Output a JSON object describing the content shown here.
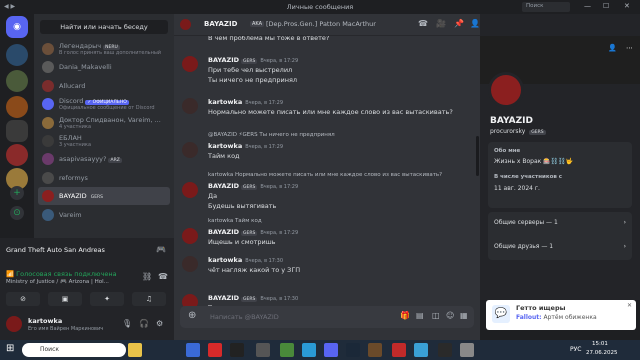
{
  "window": {
    "title": "Личные сообщения"
  },
  "search": {
    "label": "Найти или начать беседу",
    "top_placeholder": "Поиск"
  },
  "dms": [
    {
      "name": "Легендарыч",
      "tag": "NERU",
      "sub": "В голос принять ваш дополнительный",
      "color": "#6b4f3a"
    },
    {
      "name": "Dania_Makavelli",
      "tag": "",
      "sub": "",
      "color": "#5a5a5a"
    },
    {
      "name": "Allucard",
      "tag": "",
      "sub": "",
      "color": "#7a2c2c",
      "extra": "👁"
    },
    {
      "name": "Discord",
      "tag": "✓ ОФИЦИАЛЬНО",
      "sub": "Официальное сообщение от Discord",
      "color": "#5865f2"
    },
    {
      "name": "Доктор Спидванон, Vareim, ...",
      "tag": "",
      "sub": "4 участника",
      "color": "#8a6a3a"
    },
    {
      "name": "ЕБЛАН",
      "tag": "",
      "sub": "3 участника",
      "color": "#3a3a3a"
    },
    {
      "name": "asapivasayyy?",
      "tag": "ARZ",
      "sub": "",
      "color": "#6a3a6a"
    },
    {
      "name": "reformys",
      "tag": "",
      "sub": "",
      "color": "#4a4a4a"
    },
    {
      "name": "BAYAZID",
      "tag": "GERS",
      "sub": "",
      "color": "#8b1f1f"
    },
    {
      "name": "Vareim",
      "tag": "",
      "sub": "",
      "color": "#3a5a7a"
    }
  ],
  "activity": {
    "game": "Grand Theft Auto San Andreas"
  },
  "voice": {
    "status": "Голосовая связь подключена",
    "channel": "Ministry of Justice / 🎮 Arizona | Hol..."
  },
  "user": {
    "name": "kartowka",
    "status": "Его имя Вайрен Маркинович"
  },
  "chat_header": {
    "name": "BAYAZID",
    "aka_label": "AKA",
    "aka": "[Dep.Pros.Gen.] Patton MacArthur"
  },
  "messages": [
    {
      "user": "",
      "time": "",
      "reply": "",
      "text": "В чём проблема мы тоже в ответе?"
    },
    {
      "user": "BAYAZID",
      "tag": "GERS",
      "time": "Вчера, в 17:29",
      "reply": "",
      "text": "При тебе чел выстрелил",
      "text2": "Ты ничего не предпринял"
    },
    {
      "user": "kartowka",
      "tag": "",
      "time": "Вчера, в 17:29",
      "reply": "",
      "text": "Нормально можете писать или мне каждое слово из вас вытаскивать?"
    },
    {
      "user": "kartowka",
      "tag": "",
      "time": "Вчера, в 17:29",
      "reply": "@BAYAZID ⚡GERS Ты ничего не предпринял",
      "text": "Тайм код"
    },
    {
      "user": "BAYAZID",
      "tag": "GERS",
      "time": "Вчера, в 17:29",
      "reply": "kartowka Нормально можете писать или мне каждое слово из вас вытаскивать?",
      "text": "Да",
      "text2": "Будешь вытягивать"
    },
    {
      "user": "BAYAZID",
      "tag": "GERS",
      "time": "Вчера, в 17:29",
      "reply": "kartowka Тайм код",
      "text": "Ищешь и смотришь"
    },
    {
      "user": "kartowka",
      "tag": "",
      "time": "Вчера, в 17:30",
      "reply": "",
      "text": "чёт нагляж какой то у ЗГП"
    },
    {
      "user": "BAYAZID",
      "tag": "GERS",
      "time": "Вчера, в 17:30",
      "reply": "",
      "text": "Ты не знаешь что ли"
    }
  ],
  "composer": {
    "placeholder": "Написать @BAYAZID"
  },
  "profile": {
    "name": "BAYAZID",
    "username": "procurorsky",
    "tag": "GERS",
    "about_label": "Обо мне",
    "about": "Жизнь х Ворак 🎰⛓️⛓️🤟",
    "member_label": "В числе участников с",
    "member_since": "11 авг. 2024 г.",
    "mutual_servers": "Общие серверы — 1",
    "mutual_friends": "Общие друзья — 1"
  },
  "notification": {
    "title": "Гетто ищеры",
    "sender": "Fallout:",
    "text": "Артём обиженка"
  },
  "taskbar": {
    "search": "Поиск",
    "lang": "РУС",
    "time": "15:01",
    "date": "27.06.2025"
  }
}
